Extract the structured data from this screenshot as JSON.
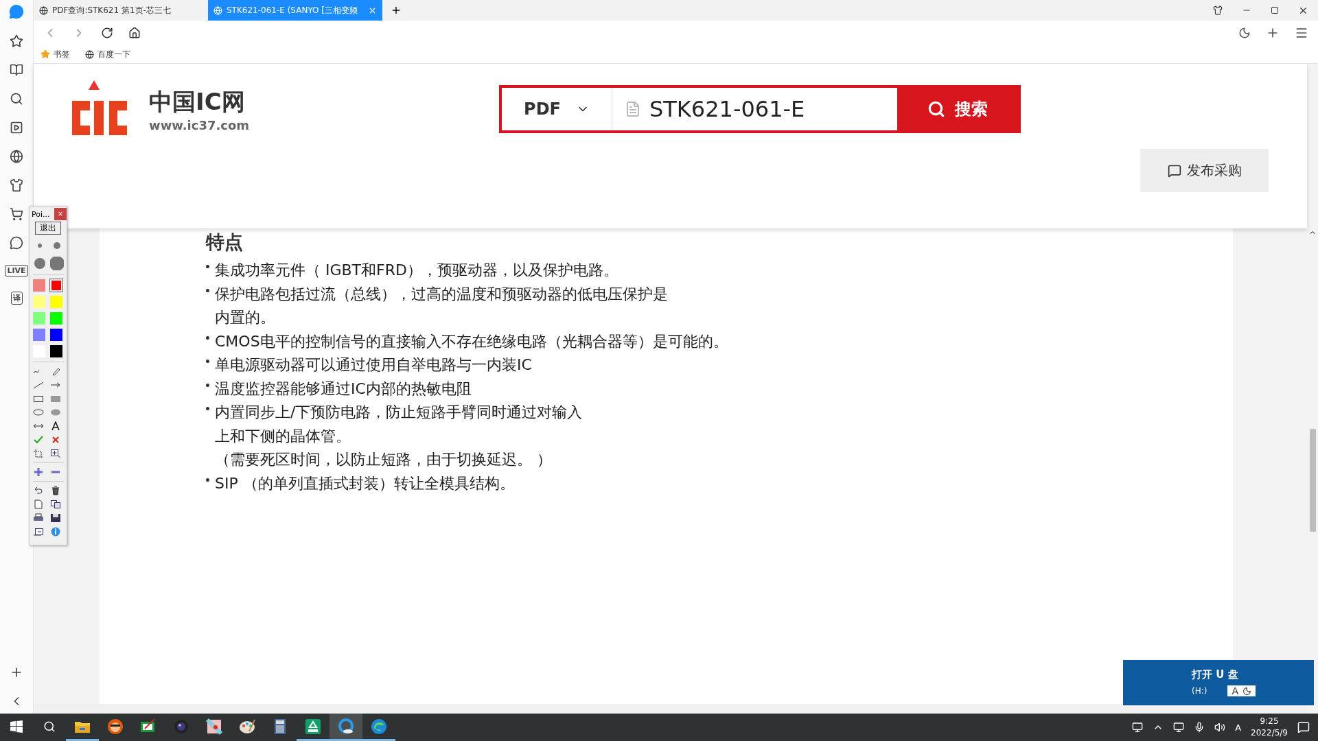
{
  "sidebar": {
    "live": "LIVE",
    "translate": "译"
  },
  "browser": {
    "tabs": [
      {
        "title": "PDF查询:STK621 第1页-芯三七",
        "selected": false
      },
      {
        "title": "STK621-061-E (SANYO [三相变频",
        "selected": true
      }
    ],
    "bookmarks": [
      {
        "label": "书签"
      },
      {
        "label": "百度一下"
      }
    ]
  },
  "site": {
    "logo_name": "中国IC网",
    "logo_url": "www.ic37.com",
    "search_type": "PDF",
    "search_value": "STK621-061-E",
    "search_button": "搜索",
    "publish_button": "发布采购"
  },
  "content": {
    "heading": "特点",
    "bullets": [
      {
        "lines": [
          "集成功率元件（ IGBT和FRD），预驱动器，以及保护电路。"
        ]
      },
      {
        "lines": [
          "保护电路包括过流（总线），过高的温度和预驱动器的低电压保护是",
          "内置的。"
        ]
      },
      {
        "lines": [
          "CMOS电平的控制信号的直接输入不存在绝缘电路（光耦合器等）是可能的。"
        ]
      },
      {
        "lines": [
          "单电源驱动器可以通过使用自举电路与一内装IC"
        ]
      },
      {
        "lines": [
          "温度监控器能够通过IC内部的热敏电阻"
        ]
      },
      {
        "lines": [
          "内置同步上/下预防电路，防止短路手臂同时通过对输入",
          "上和下侧的晶体管。",
          "（需要死区时间，以防止短路，由于切换延迟。 ）"
        ]
      },
      {
        "lines": [
          "SIP （的单列直插式封装）转让全模具结构。"
        ]
      }
    ]
  },
  "paint_tool": {
    "title": "Poi...",
    "close": "×",
    "exit": "退出",
    "swatches": [
      {
        "color": "#f08080",
        "selected": false
      },
      {
        "color": "#ff0000",
        "selected": true
      },
      {
        "color": "#ffff80",
        "selected": false
      },
      {
        "color": "#ffff00",
        "selected": false
      },
      {
        "color": "#80ff80",
        "selected": false
      },
      {
        "color": "#00ff00",
        "selected": false
      },
      {
        "color": "#8080ff",
        "selected": false
      },
      {
        "color": "#0000ff",
        "selected": false
      },
      {
        "color": "#ffffff",
        "selected": false
      },
      {
        "color": "#000000",
        "selected": false
      }
    ]
  },
  "notification": {
    "title": "打开 U 盘",
    "drive": "(H:)",
    "ime_label": "A"
  },
  "taskbar": {
    "apps": [
      {
        "kind": "explorer",
        "running": true,
        "active": false
      },
      {
        "kind": "mascot",
        "running": false,
        "active": false
      },
      {
        "kind": "board",
        "running": false,
        "active": false
      },
      {
        "kind": "camera",
        "running": false,
        "active": false
      },
      {
        "kind": "paint",
        "running": false,
        "active": false
      },
      {
        "kind": "palette",
        "running": false,
        "active": false
      },
      {
        "kind": "calculator",
        "running": false,
        "active": false
      },
      {
        "kind": "pdf",
        "running": true,
        "active": false
      },
      {
        "kind": "browser",
        "running": true,
        "active": true
      },
      {
        "kind": "edge",
        "running": true,
        "active": false
      }
    ],
    "ime": "A",
    "time": "9:25",
    "date": "2022/5/9"
  }
}
